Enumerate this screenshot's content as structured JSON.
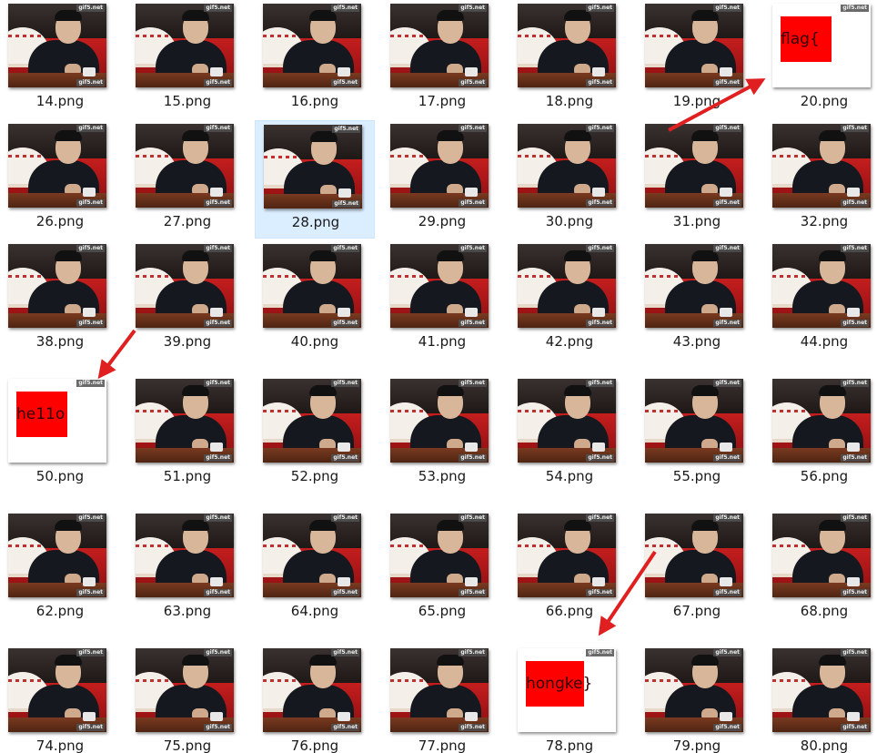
{
  "rows": [
    {
      "items": [
        {
          "name": "14.png",
          "kind": "photo"
        },
        {
          "name": "15.png",
          "kind": "photo"
        },
        {
          "name": "16.png",
          "kind": "photo"
        },
        {
          "name": "17.png",
          "kind": "photo"
        },
        {
          "name": "18.png",
          "kind": "photo"
        },
        {
          "name": "19.png",
          "kind": "photo"
        },
        {
          "name": "20.png",
          "kind": "flag",
          "text": "flag{"
        }
      ]
    },
    {
      "items": [
        {
          "name": "26.png",
          "kind": "photo"
        },
        {
          "name": "27.png",
          "kind": "photo"
        },
        {
          "name": "28.png",
          "kind": "photo",
          "selected": true
        },
        {
          "name": "29.png",
          "kind": "photo"
        },
        {
          "name": "30.png",
          "kind": "photo"
        },
        {
          "name": "31.png",
          "kind": "photo"
        },
        {
          "name": "32.png",
          "kind": "photo"
        }
      ]
    },
    {
      "items": [
        {
          "name": "38.png",
          "kind": "photo"
        },
        {
          "name": "39.png",
          "kind": "photo"
        },
        {
          "name": "40.png",
          "kind": "photo"
        },
        {
          "name": "41.png",
          "kind": "photo"
        },
        {
          "name": "42.png",
          "kind": "photo"
        },
        {
          "name": "43.png",
          "kind": "photo"
        },
        {
          "name": "44.png",
          "kind": "photo"
        }
      ]
    },
    {
      "items": [
        {
          "name": "50.png",
          "kind": "flag",
          "text": "he11o"
        },
        {
          "name": "51.png",
          "kind": "photo"
        },
        {
          "name": "52.png",
          "kind": "photo"
        },
        {
          "name": "53.png",
          "kind": "photo"
        },
        {
          "name": "54.png",
          "kind": "photo"
        },
        {
          "name": "55.png",
          "kind": "photo"
        },
        {
          "name": "56.png",
          "kind": "photo"
        }
      ]
    },
    {
      "items": [
        {
          "name": "62.png",
          "kind": "photo"
        },
        {
          "name": "63.png",
          "kind": "photo"
        },
        {
          "name": "64.png",
          "kind": "photo"
        },
        {
          "name": "65.png",
          "kind": "photo"
        },
        {
          "name": "66.png",
          "kind": "photo"
        },
        {
          "name": "67.png",
          "kind": "photo"
        },
        {
          "name": "68.png",
          "kind": "photo"
        }
      ]
    },
    {
      "items": [
        {
          "name": "74.png",
          "kind": "photo"
        },
        {
          "name": "75.png",
          "kind": "photo"
        },
        {
          "name": "76.png",
          "kind": "photo"
        },
        {
          "name": "77.png",
          "kind": "photo"
        },
        {
          "name": "78.png",
          "kind": "flag",
          "text": "hongke}"
        },
        {
          "name": "79.png",
          "kind": "photo"
        },
        {
          "name": "80.png",
          "kind": "photo"
        }
      ]
    }
  ],
  "watermark": "gif5.net",
  "colors": {
    "arrow": "#e02020",
    "selection": "#dbeeff",
    "flag_box": "#ff0000"
  }
}
